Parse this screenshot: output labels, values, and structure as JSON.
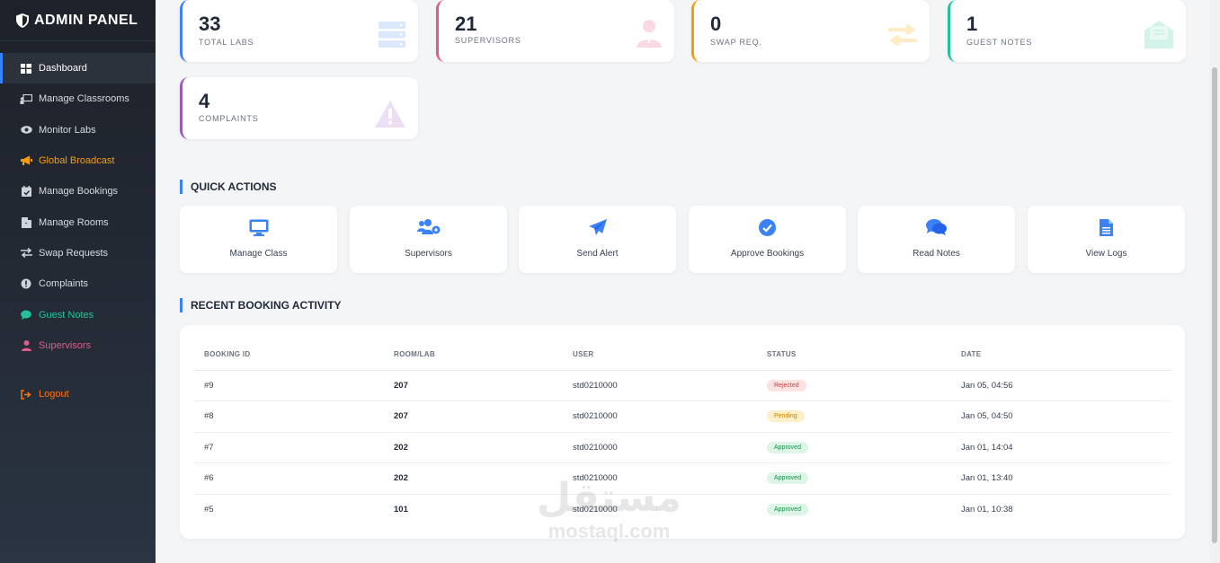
{
  "brand": {
    "title": "ADMIN PANEL"
  },
  "sidebar": {
    "items": [
      {
        "label": "Dashboard",
        "icon": "grid-icon"
      },
      {
        "label": "Manage Classrooms",
        "icon": "classroom-icon"
      },
      {
        "label": "Monitor Labs",
        "icon": "eye-icon"
      },
      {
        "label": "Global Broadcast",
        "icon": "megaphone-icon"
      },
      {
        "label": "Manage Bookings",
        "icon": "calendar-check-icon"
      },
      {
        "label": "Manage Rooms",
        "icon": "door-icon"
      },
      {
        "label": "Swap Requests",
        "icon": "swap-icon"
      },
      {
        "label": "Complaints",
        "icon": "exclamation-icon"
      },
      {
        "label": "Guest Notes",
        "icon": "comment-icon"
      },
      {
        "label": "Supervisors",
        "icon": "user-icon"
      }
    ],
    "logout": "Logout"
  },
  "stats": [
    {
      "value": "33",
      "label": "TOTAL LABS",
      "color": "#3b82f6"
    },
    {
      "value": "21",
      "label": "SUPERVISORS",
      "color": "#e25a8a"
    },
    {
      "value": "0",
      "label": "SWAP REQ.",
      "color": "#f59e0b"
    },
    {
      "value": "1",
      "label": "GUEST NOTES",
      "color": "#22c39a"
    },
    {
      "value": "4",
      "label": "COMPLAINTS",
      "color": "#9b59b6"
    }
  ],
  "quick_actions": {
    "title": "QUICK ACTIONS",
    "items": [
      {
        "label": "Manage Class",
        "icon": "monitor-icon"
      },
      {
        "label": "Supervisors",
        "icon": "users-cog-icon"
      },
      {
        "label": "Send Alert",
        "icon": "paper-plane-icon"
      },
      {
        "label": "Approve Bookings",
        "icon": "check-circle-icon"
      },
      {
        "label": "Read Notes",
        "icon": "comments-icon"
      },
      {
        "label": "View Logs",
        "icon": "file-icon"
      }
    ]
  },
  "recent": {
    "title": "RECENT BOOKING ACTIVITY",
    "columns": [
      "BOOKING ID",
      "ROOM/LAB",
      "USER",
      "STATUS",
      "DATE"
    ],
    "rows": [
      {
        "id": "#9",
        "room": "207",
        "user": "std0210000",
        "status": "Rejected",
        "date": "Jan 05, 04:56"
      },
      {
        "id": "#8",
        "room": "207",
        "user": "std0210000",
        "status": "Pending",
        "date": "Jan 05, 04:50"
      },
      {
        "id": "#7",
        "room": "202",
        "user": "std0210000",
        "status": "Approved",
        "date": "Jan 01, 14:04"
      },
      {
        "id": "#6",
        "room": "202",
        "user": "std0210000",
        "status": "Approved",
        "date": "Jan 01, 13:40"
      },
      {
        "id": "#5",
        "room": "101",
        "user": "std0210000",
        "status": "Approved",
        "date": "Jan 01, 10:38"
      }
    ]
  },
  "watermark": {
    "arabic": "مستقل",
    "latin": "mostaql.com"
  }
}
